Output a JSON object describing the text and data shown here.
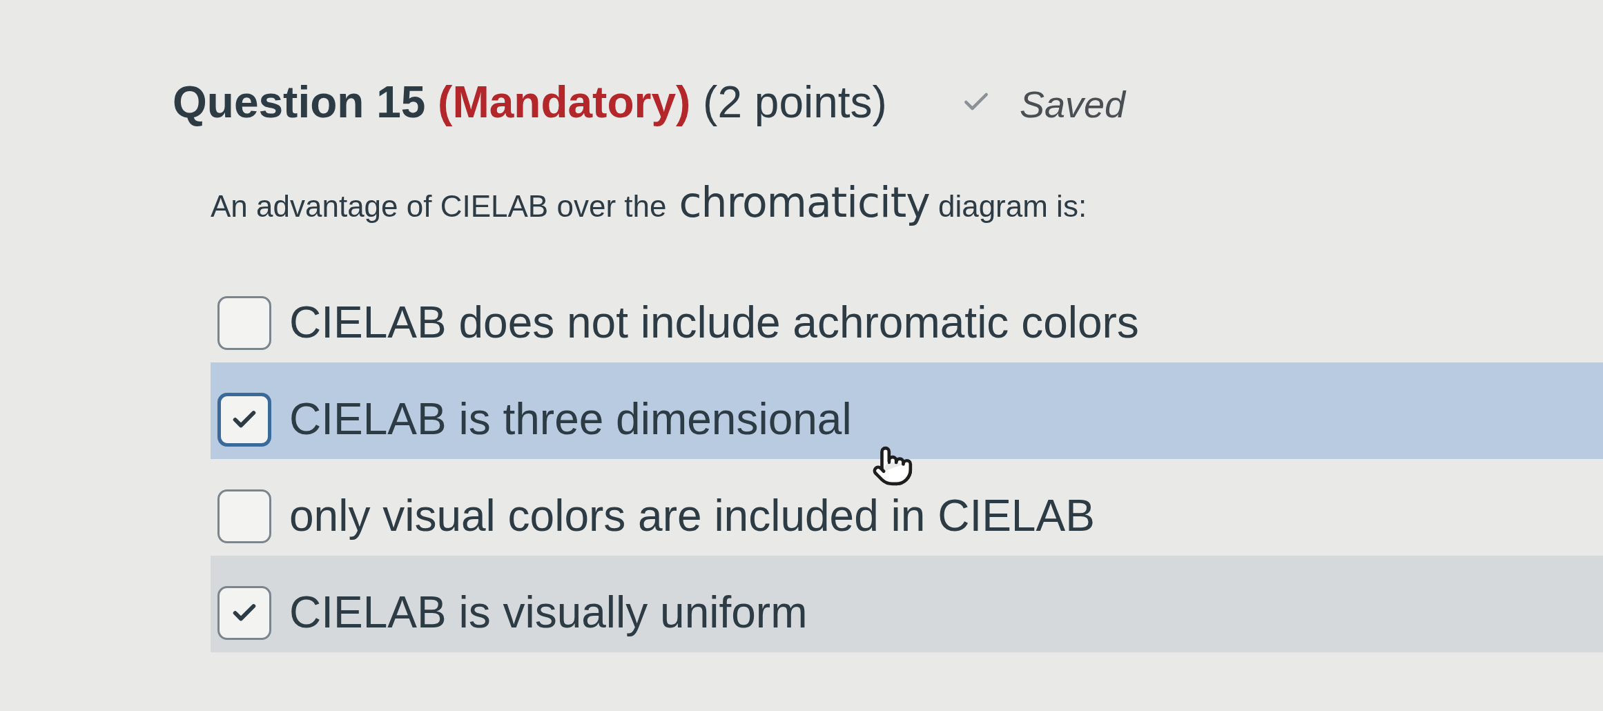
{
  "question": {
    "number": "Question 15",
    "required": "(Mandatory)",
    "points": "(2 points)"
  },
  "save_status": {
    "label": "Saved",
    "saved": true
  },
  "prompt": [
    {
      "kind": "plain",
      "text": "An advantage of CIELAB over the"
    },
    {
      "kind": "large",
      "text": "chromaticity"
    },
    {
      "kind": "plain",
      "text": "diagram is:"
    }
  ],
  "options": [
    {
      "label": "CIELAB does not include achromatic colors",
      "checked": false,
      "hovered": false
    },
    {
      "label": "CIELAB is three dimensional",
      "checked": true,
      "hovered": true
    },
    {
      "label": "only visual colors are included in CIELAB",
      "checked": false,
      "hovered": false
    },
    {
      "label": "CIELAB is visually uniform",
      "checked": true,
      "hovered": false
    }
  ],
  "pointer": {
    "visible": true
  }
}
